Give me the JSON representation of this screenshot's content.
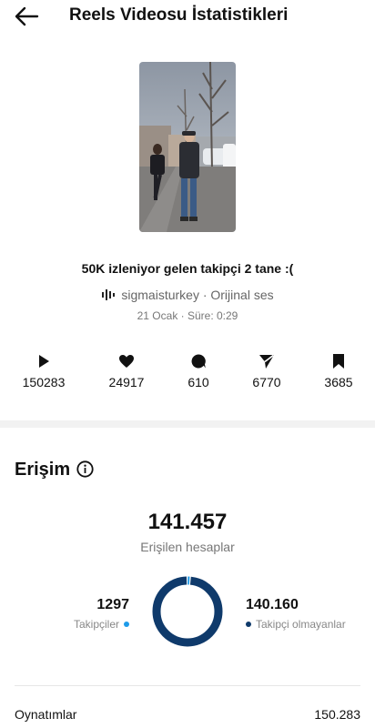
{
  "header": {
    "title": "Reels Videosu İstatistikleri",
    "back_icon": "arrow-left-icon"
  },
  "reel": {
    "caption": "50K izleniyor gelen takipçi 2 tane :(",
    "audio": "sigmaisturkey · Orijinal ses",
    "meta": "21 Ocak · Süre: 0:29"
  },
  "stats": [
    {
      "icon": "play-icon",
      "value": "150283"
    },
    {
      "icon": "heart-icon",
      "value": "24917"
    },
    {
      "icon": "comment-icon",
      "value": "610"
    },
    {
      "icon": "share-icon",
      "value": "6770"
    },
    {
      "icon": "bookmark-icon",
      "value": "3685"
    }
  ],
  "reach": {
    "title": "Erişim",
    "info_icon": "info-icon",
    "total": "141.457",
    "total_label": "Erişilen hesaplar",
    "followers": {
      "value": "1297",
      "label": "Takipçiler",
      "color": "#1e9be9",
      "fraction": 0.0092
    },
    "non_followers": {
      "value": "140.160",
      "label": "Takipçi olmayanlar",
      "color": "#0f3a6b",
      "fraction": 0.9908
    }
  },
  "plays": {
    "label": "Oynatımlar",
    "value": "150.283"
  },
  "colors": {
    "accent_dark": "#0f3a6b",
    "accent_light": "#1e9be9",
    "divider": "#f2f2f2"
  }
}
